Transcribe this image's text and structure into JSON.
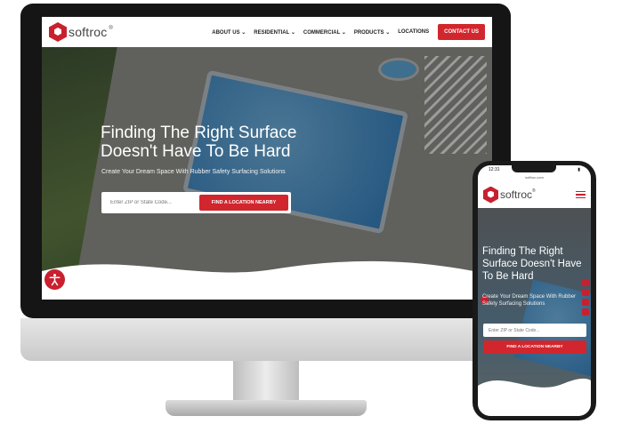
{
  "desktop": {
    "logo_text": "softroc",
    "logo_mark": "®",
    "nav": [
      {
        "label": "ABOUT US"
      },
      {
        "label": "RESIDENTIAL"
      },
      {
        "label": "COMMERCIAL"
      },
      {
        "label": "PRODUCTS"
      },
      {
        "label": "LOCATIONS"
      }
    ],
    "contact_label": "CONTACT US",
    "hero_title_1": "Finding The Right Surface",
    "hero_title_2": "Doesn't Have To Be Hard",
    "hero_subtitle": "Create Your Dream Space With Rubber Safety Surfacing Solutions",
    "search_placeholder": "Enter ZIP or State Code...",
    "search_button": "FIND A LOCATION NEARBY",
    "accessibility_icon": "accessibility-icon"
  },
  "phone": {
    "time": "12:31",
    "url": "softroc.com",
    "logo_text": "softroc",
    "logo_mark": "®",
    "menu_icon": "hamburger-menu-icon",
    "hero_title": "Finding The Right Surface Doesn't Have To Be Hard",
    "hero_subtitle": "Create Your Dream Space With Rubber Safety Surfacing Solutions",
    "search_placeholder": "Enter ZIP or State Code...",
    "search_button": "FIND A LOCATION NEARBY",
    "social_icons": [
      "facebook-icon",
      "instagram-icon",
      "email-icon",
      "yelp-icon"
    ]
  },
  "colors": {
    "brand_red": "#d2262e",
    "logo_red": "#c8202f"
  }
}
